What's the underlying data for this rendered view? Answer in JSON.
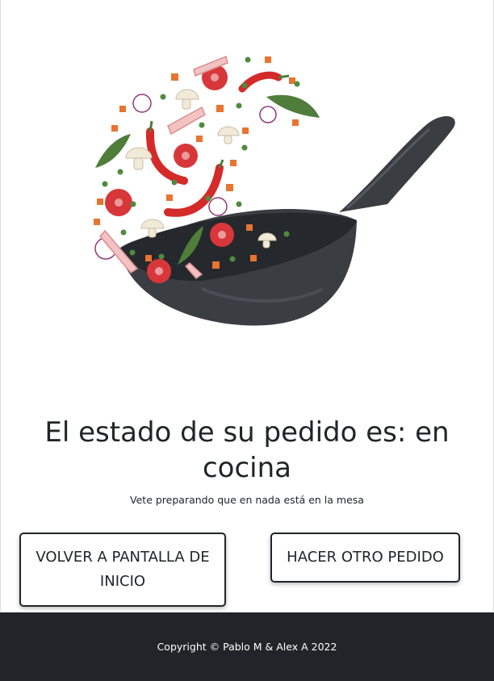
{
  "hero": {
    "image_name": "wok-with-tossed-vegetables"
  },
  "status": {
    "title": "El estado de su pedido es: en cocina",
    "subtitle": "Vete preparando que en nada está en la mesa"
  },
  "actions": {
    "home_label": "VOLVER A PANTALLA DE INICIO",
    "new_order_label": "HACER OTRO PEDIDO"
  },
  "footer": {
    "copyright": "Copyright © Pablo M & Alex A 2022"
  },
  "colors": {
    "footer_bg": "#212529",
    "text": "#212529",
    "pan": "#3a3d42",
    "tomato": "#d8373a",
    "pepper": "#d42a2a",
    "herb": "#4f7d3a",
    "carrot": "#e8742f"
  }
}
